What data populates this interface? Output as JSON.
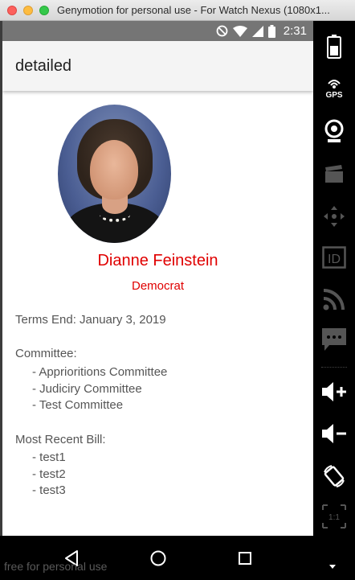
{
  "window": {
    "title": "Genymotion for personal use - For Watch Nexus (1080x1..."
  },
  "statusbar": {
    "time": "2:31"
  },
  "app": {
    "title": "detailed"
  },
  "senator": {
    "name": "Dianne Feinstein",
    "party": "Democrat",
    "terms_end": "Terms End: January 3, 2019",
    "committee_label": "Committee:",
    "committees": [
      "- Apprioritions Committee",
      "- Judiciry Committee",
      "- Test Committee"
    ],
    "bill_label": "Most Recent Bill:",
    "bills": [
      "- test1",
      "- test2",
      "- test3"
    ]
  },
  "navbar": {
    "watermark": "free for personal use"
  },
  "sidebar": {
    "gps_label": "GPS",
    "id_label": "ID",
    "scale_label": "1:1"
  },
  "colors": {
    "accent_red": "#e00000",
    "statusbar": "#757575",
    "appbar": "#f4f4f4"
  },
  "icons": [
    "battery-icon",
    "gps-icon",
    "camera-icon",
    "capture-icon",
    "dpad-icon",
    "id-icon",
    "network-icon",
    "sms-icon",
    "volume-up-icon",
    "volume-down-icon",
    "rotate-icon",
    "scale-icon",
    "back-icon",
    "home-icon",
    "recent-apps-icon"
  ]
}
